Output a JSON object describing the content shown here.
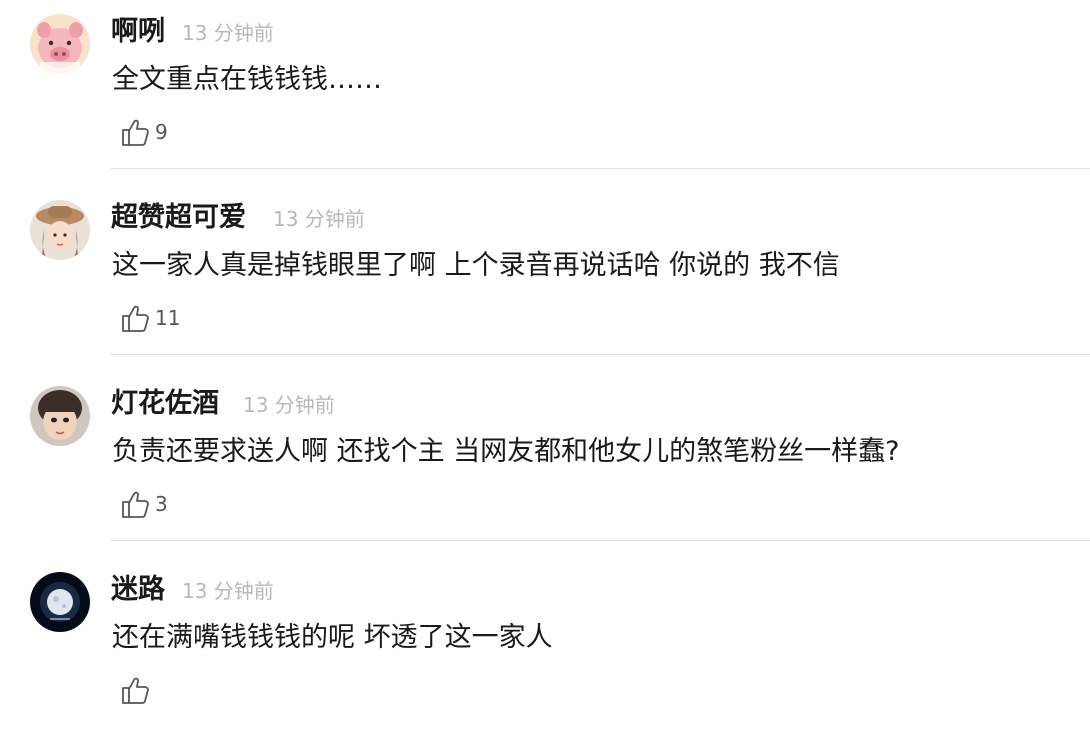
{
  "comments": [
    {
      "username": "啊咧",
      "time": "13 分钟前",
      "text": "全文重点在钱钱钱……",
      "likes": "9",
      "avatar": "pink-pig-avatar"
    },
    {
      "username": "超赞超可爱",
      "time": "13 分钟前",
      "text": "这一家人真是掉钱眼里了啊 上个录音再说话哈 你说的 我不信",
      "likes": "11",
      "avatar": "girl-hat-avatar"
    },
    {
      "username": "灯花佐酒",
      "time": "13 分钟前",
      "text": "负责还要求送人啊 还找个主 当网友都和他女儿的煞笔粉丝一样蠢?",
      "likes": "3",
      "avatar": "child-face-avatar"
    },
    {
      "username": "迷路",
      "time": "13 分钟前",
      "text": "还在满嘴钱钱钱的呢 坏透了这一家人",
      "likes": "",
      "avatar": "moon-avatar"
    }
  ],
  "icons": {
    "like": "thumbs-up-outline-icon"
  },
  "colors": {
    "username": "#1a1a1a",
    "time": "#b8b8b8",
    "text": "#1a1a1a",
    "like": "#555555",
    "divider": "#e2e2e2"
  }
}
